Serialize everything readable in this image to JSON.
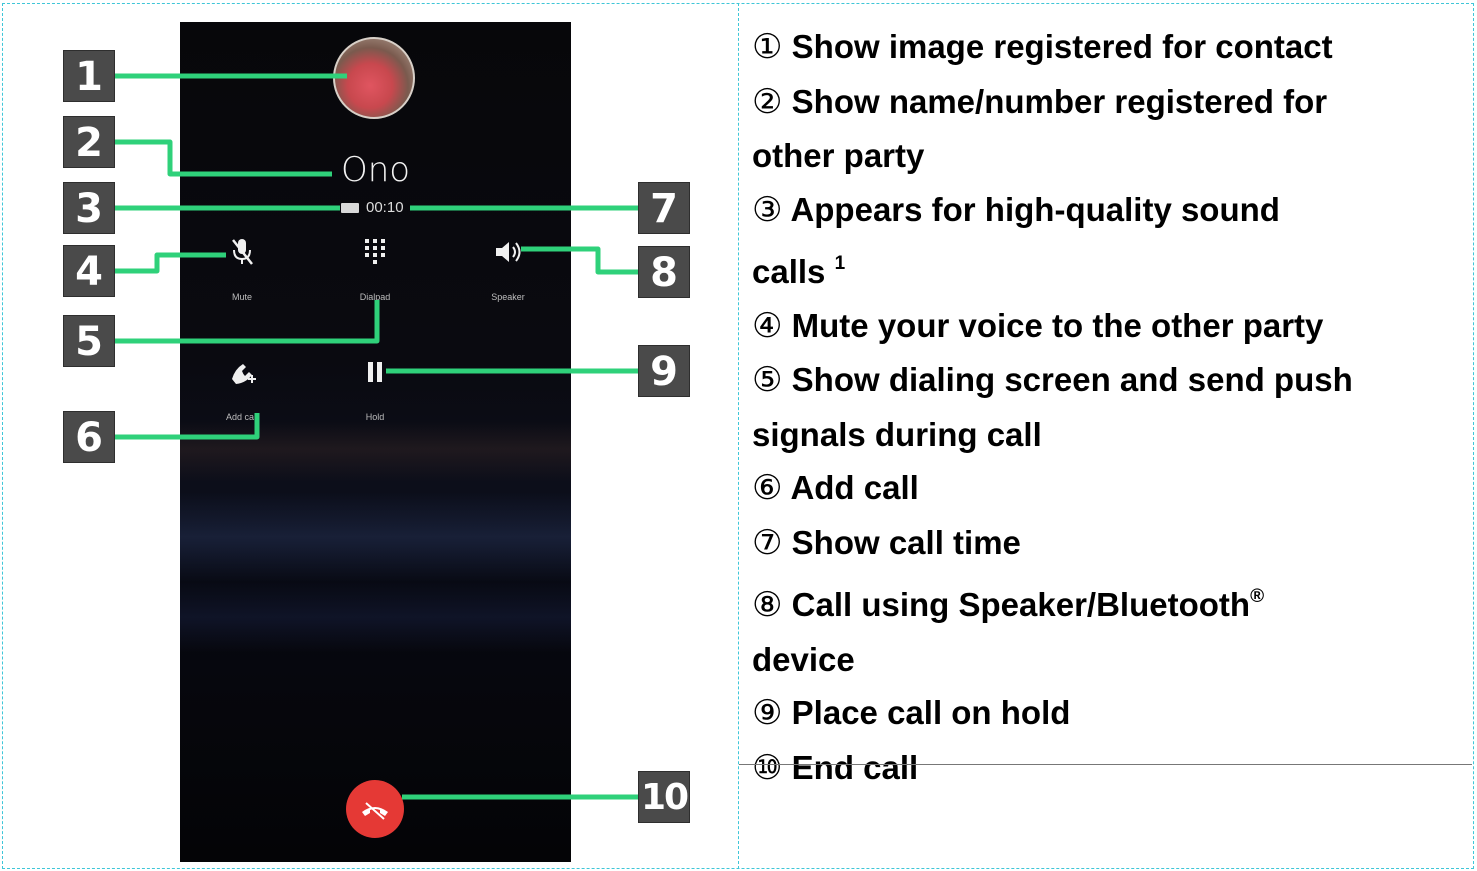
{
  "phone": {
    "contact_name": "Ono",
    "call_time": "00:10",
    "controls": {
      "mute": "Mute",
      "dialpad": "Dialpad",
      "speaker": "Speaker",
      "add_call": "Add call",
      "hold": "Hold"
    }
  },
  "callouts": [
    "1",
    "2",
    "3",
    "4",
    "5",
    "6",
    "7",
    "8",
    "9",
    "10"
  ],
  "descriptions": {
    "d1": {
      "num": "①",
      "text": "Show image registered for contact"
    },
    "d2": {
      "num": "②",
      "text": "Show name/number registered for",
      "cont": "other party"
    },
    "d3": {
      "num": "③",
      "text": "Appears for high-quality sound",
      "cont": "calls",
      "sup": "1"
    },
    "d4": {
      "num": "④",
      "text": "Mute your voice to the other party"
    },
    "d5": {
      "num": "⑤",
      "text": "Show dialing screen and send push",
      "cont": "signals during call"
    },
    "d6": {
      "num": "⑥",
      "text": "Add call"
    },
    "d7": {
      "num": "⑦",
      "text": "Show call time"
    },
    "d8": {
      "num": "⑧",
      "text": "Call using Speaker/Bluetooth",
      "sup": "®",
      "cont": "device"
    },
    "d9": {
      "num": "⑨",
      "text": "Place call on hold"
    },
    "d10": {
      "num": "⑩",
      "text": "End call"
    }
  },
  "colors": {
    "leader_line": "#2fd17a",
    "callout_box": "#4a4a4a",
    "end_call": "#e53935",
    "frame": "#3fc6d8"
  },
  "icons": [
    "mic-off-icon",
    "dialpad-icon",
    "speaker-icon",
    "add-call-icon",
    "pause-icon",
    "call-end-icon",
    "hd-voice-icon"
  ]
}
